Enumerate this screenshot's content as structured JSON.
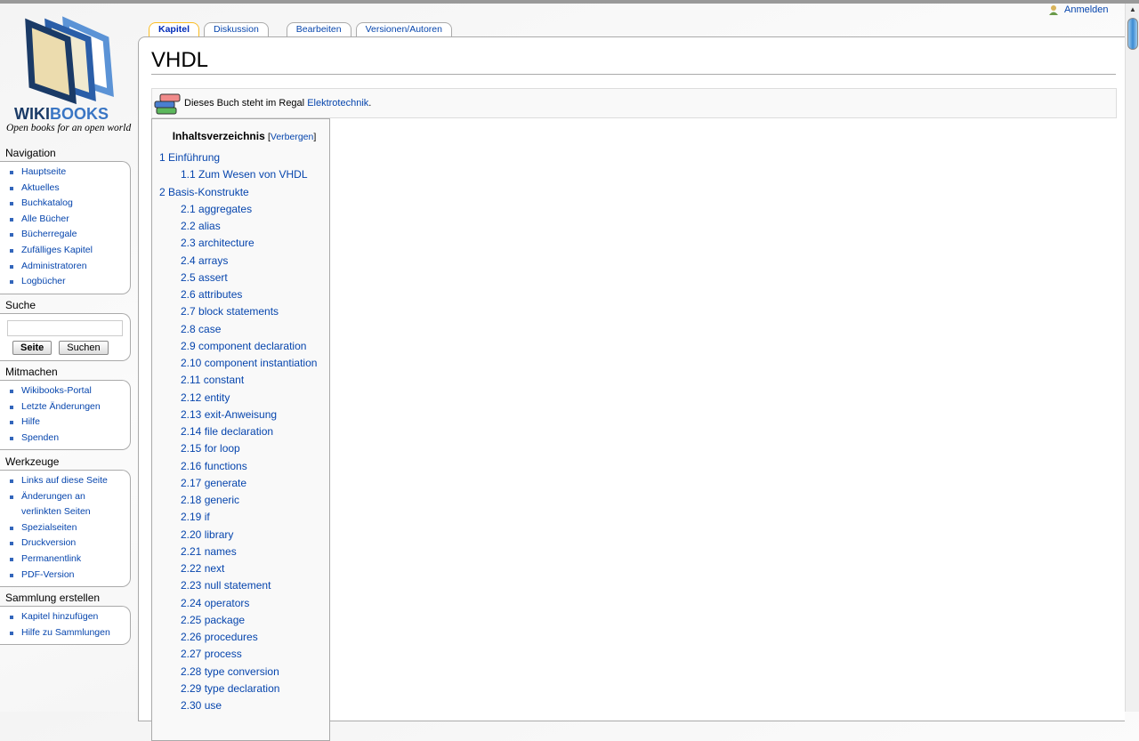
{
  "logo": {
    "word_a": "WIKI",
    "word_b": "BOOKS",
    "tagline": "Open books for an open world"
  },
  "personal": {
    "login": "Anmelden"
  },
  "tabs": [
    {
      "label": "Kapitel"
    },
    {
      "label": "Diskussion"
    },
    {
      "label": "Bearbeiten"
    },
    {
      "label": "Versionen/Autoren"
    }
  ],
  "page": {
    "title": "VHDL",
    "regal_text": "Dieses Buch steht im Regal ",
    "regal_link": "Elektrotechnik",
    "regal_end": "."
  },
  "sidebar": {
    "navigation": {
      "title": "Navigation",
      "items": [
        "Hauptseite",
        "Aktuelles",
        "Buchkatalog",
        "Alle Bücher",
        "Bücherregale",
        "Zufälliges Kapitel",
        "Administratoren",
        "Logbücher"
      ]
    },
    "search": {
      "title": "Suche",
      "value": "",
      "go": "Seite",
      "search": "Suchen"
    },
    "participate": {
      "title": "Mitmachen",
      "items": [
        "Wikibooks-Portal",
        "Letzte Änderungen",
        "Hilfe",
        "Spenden"
      ]
    },
    "tools": {
      "title": "Werkzeuge",
      "items": [
        "Links auf diese Seite",
        "Änderungen an",
        "verlinkten Seiten",
        "Spezialseiten",
        "Druckversion",
        "Permanentlink",
        "PDF-Version"
      ]
    },
    "collection": {
      "title": "Sammlung erstellen",
      "items": [
        "Kapitel hinzufügen",
        "Hilfe zu Sammlungen"
      ]
    }
  },
  "toc": {
    "title": "Inhaltsverzeichnis",
    "open": "[",
    "toggle": "Verbergen",
    "close": "]",
    "items": [
      {
        "level": 1,
        "text": "1 Einführung"
      },
      {
        "level": 2,
        "text": "1.1 Zum Wesen von VHDL"
      },
      {
        "level": 1,
        "text": "2 Basis-Konstrukte"
      },
      {
        "level": 2,
        "text": "2.1 aggregates"
      },
      {
        "level": 2,
        "text": "2.2 alias"
      },
      {
        "level": 2,
        "text": "2.3 architecture"
      },
      {
        "level": 2,
        "text": "2.4 arrays"
      },
      {
        "level": 2,
        "text": "2.5 assert"
      },
      {
        "level": 2,
        "text": "2.6 attributes"
      },
      {
        "level": 2,
        "text": "2.7 block statements"
      },
      {
        "level": 2,
        "text": "2.8 case"
      },
      {
        "level": 2,
        "text": "2.9 component declaration"
      },
      {
        "level": 2,
        "text": "2.10 component instantiation"
      },
      {
        "level": 2,
        "text": "2.11 constant"
      },
      {
        "level": 2,
        "text": "2.12 entity"
      },
      {
        "level": 2,
        "text": "2.13 exit-Anweisung"
      },
      {
        "level": 2,
        "text": "2.14 file declaration"
      },
      {
        "level": 2,
        "text": "2.15 for loop"
      },
      {
        "level": 2,
        "text": "2.16 functions"
      },
      {
        "level": 2,
        "text": "2.17 generate"
      },
      {
        "level": 2,
        "text": "2.18 generic"
      },
      {
        "level": 2,
        "text": "2.19 if"
      },
      {
        "level": 2,
        "text": "2.20 library"
      },
      {
        "level": 2,
        "text": "2.21 names"
      },
      {
        "level": 2,
        "text": "2.22 next"
      },
      {
        "level": 2,
        "text": "2.23 null statement"
      },
      {
        "level": 2,
        "text": "2.24 operators"
      },
      {
        "level": 2,
        "text": "2.25 package"
      },
      {
        "level": 2,
        "text": "2.26 procedures"
      },
      {
        "level": 2,
        "text": "2.27 process"
      },
      {
        "level": 2,
        "text": "2.28 type conversion"
      },
      {
        "level": 2,
        "text": "2.29 type declaration"
      },
      {
        "level": 2,
        "text": "2.30 use"
      }
    ]
  }
}
